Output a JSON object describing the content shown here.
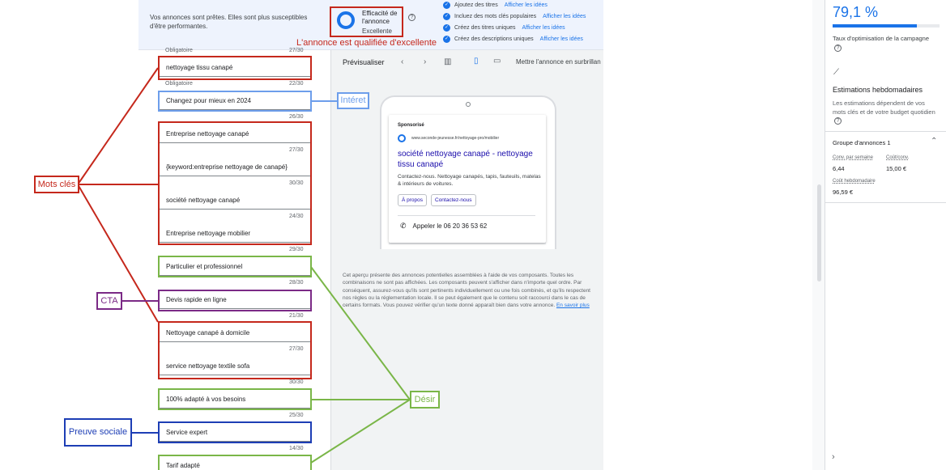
{
  "topbar": {
    "message": "Vos annonces sont prêtes. Elles sont plus susceptibles d'être performantes.",
    "efficiency_title": "Efficacité de l'annonce",
    "efficiency_value": "Excellente",
    "help_glyph": "?",
    "tips": [
      {
        "label": "Ajoutez des titres",
        "link": "Afficher les idées"
      },
      {
        "label": "Incluez des mots clés populaires",
        "link": "Afficher les idées"
      },
      {
        "label": "Créez des titres uniques",
        "link": "Afficher les idées"
      },
      {
        "label": "Créez des descriptions uniques",
        "link": "Afficher les idées"
      }
    ]
  },
  "fields": {
    "required_label": "Obligatoire",
    "items": [
      {
        "value": "nettoyage tissu canapé",
        "count": "27/30"
      },
      {
        "value": "Changez pour mieux en 2024",
        "count": "22/30"
      },
      {
        "value": "Entreprise nettoyage canapé",
        "count": "26/30"
      },
      {
        "value": "{keyword:entreprise nettoyage de canapé}",
        "count": "27/30"
      },
      {
        "value": "société nettoyage canapé",
        "count": "30/30"
      },
      {
        "value": "Entreprise nettoyage mobilier",
        "count": "24/30"
      },
      {
        "value": "Particulier et professionnel",
        "count": "29/30"
      },
      {
        "value": "Devis rapide en ligne",
        "count": "28/30"
      },
      {
        "value": "Nettoyage canapé à domicile",
        "count": "21/30"
      },
      {
        "value": "service nettoyage textile sofa",
        "count": "27/30"
      },
      {
        "value": "100% adapté à vos besoins",
        "count": "30/30"
      },
      {
        "value": "Service expert",
        "count": "25/30"
      },
      {
        "value": "Tarif adapté",
        "count": "14/30"
      }
    ]
  },
  "preview": {
    "title": "Prévisualiser",
    "highlight_label": "Mettre l'annonce en surbrillan",
    "ad": {
      "sponsored": "Sponsorisé",
      "url": "www.seconde-jeunesse.fr/nettoyage-pro/mobilier",
      "headline": "société nettoyage canapé - nettoyage tissu canapé",
      "description": "Contactez-nous. Nettoyage canapés, tapis, fauteuils, matelas & intérieurs de voitures.",
      "chip_about": "À propos",
      "chip_contact": "Contactez-nous",
      "call": "Appeler le 06 20 36 53 62"
    },
    "note": "Cet aperçu présente des annonces potentielles assemblées à l'aide de vos composants. Toutes les combinaisons ne sont pas affichées. Les composants peuvent s'afficher dans n'importe quel ordre. Par conséquent, assurez-vous qu'ils sont pertinents individuellement ou une fois combinés, et qu'ils respectent nos règles ou la réglementation locale. Il se peut également que le contenu soit raccourci dans le cas de certains formats. Vous pouvez vérifier qu'un texte donné apparaît bien dans votre annonce.",
    "note_link": "En savoir plus"
  },
  "sidebar": {
    "optimization_value": "79,1 %",
    "optimization_fraction": 0.791,
    "optimization_label": "Taux d'optimisation de la campagne",
    "weekly_title": "Estimations hebdomadaires",
    "weekly_desc": "Les estimations dépendent de vos mots clés et de votre budget quotidien",
    "group_title": "Groupe d'annonces 1",
    "metrics": [
      {
        "label": "Conv. par semaine",
        "value": "6,44"
      },
      {
        "label": "Coût/conv.",
        "value": "15,00 €"
      },
      {
        "label": "Coût hebdomadaire",
        "value": "96,59 €"
      }
    ]
  },
  "annotations": {
    "efficiency_caption": "L'annonce est qualifiée d'excellente",
    "mots_cles": "Mots clés",
    "interet": "Intéret",
    "cta": "CTA",
    "desir": "Désir",
    "preuve_sociale": "Preuve sociale"
  },
  "colors": {
    "accent": "#1a73e8",
    "anno_red": "#c5281c",
    "anno_blue": "#6d9eeb",
    "anno_purple": "#7b2a86",
    "anno_green": "#7ab648",
    "anno_navy": "#1d3eb5"
  }
}
